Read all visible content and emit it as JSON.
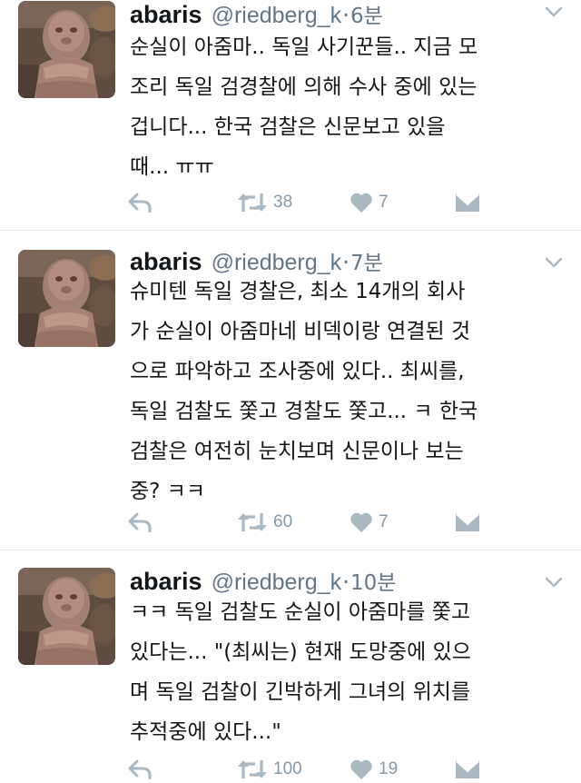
{
  "colors": {
    "icon_gray": "#aab8c2",
    "text_gray": "#657786",
    "divider": "#e1e8ed"
  },
  "tweets": [
    {
      "name": "abaris",
      "handle": "@riedberg_k",
      "separator": "·",
      "time": "6분",
      "lines": [
        "순실이 아줌마.. 독일 사기꾼들.. 지금 모",
        "조리 독일 검경찰에 의해 수사 중에 있는",
        "겁니다... 한국 검찰은 신문보고 있을",
        "때... ㅠㅠ"
      ],
      "retweets": "38",
      "likes": "7"
    },
    {
      "name": "abaris",
      "handle": "@riedberg_k",
      "separator": "·",
      "time": "7분",
      "lines": [
        "슈미텐 독일 경찰은, 최소 14개의 회사",
        "가 순실이 아줌마네 비덱이랑 연결된 것",
        "으로 파악하고 조사중에 있다.. 최씨를,",
        "독일 검찰도 쫓고 경찰도 쫓고... ㅋ 한국",
        "검찰은 여전히 눈치보며 신문이나 보는",
        "중? ㅋㅋ"
      ],
      "retweets": "60",
      "likes": "7"
    },
    {
      "name": "abaris",
      "handle": "@riedberg_k",
      "separator": "·",
      "time": "10분",
      "lines": [
        "ㅋㅋ 독일 검찰도 순실이 아줌마를 쫓고",
        "있다는... \"(최씨는) 현재 도망중에 있으",
        "며 독일 검찰이 긴박하게 그녀의 위치를",
        "추적중에 있다...\""
      ],
      "retweets": "100",
      "likes": "19"
    }
  ]
}
